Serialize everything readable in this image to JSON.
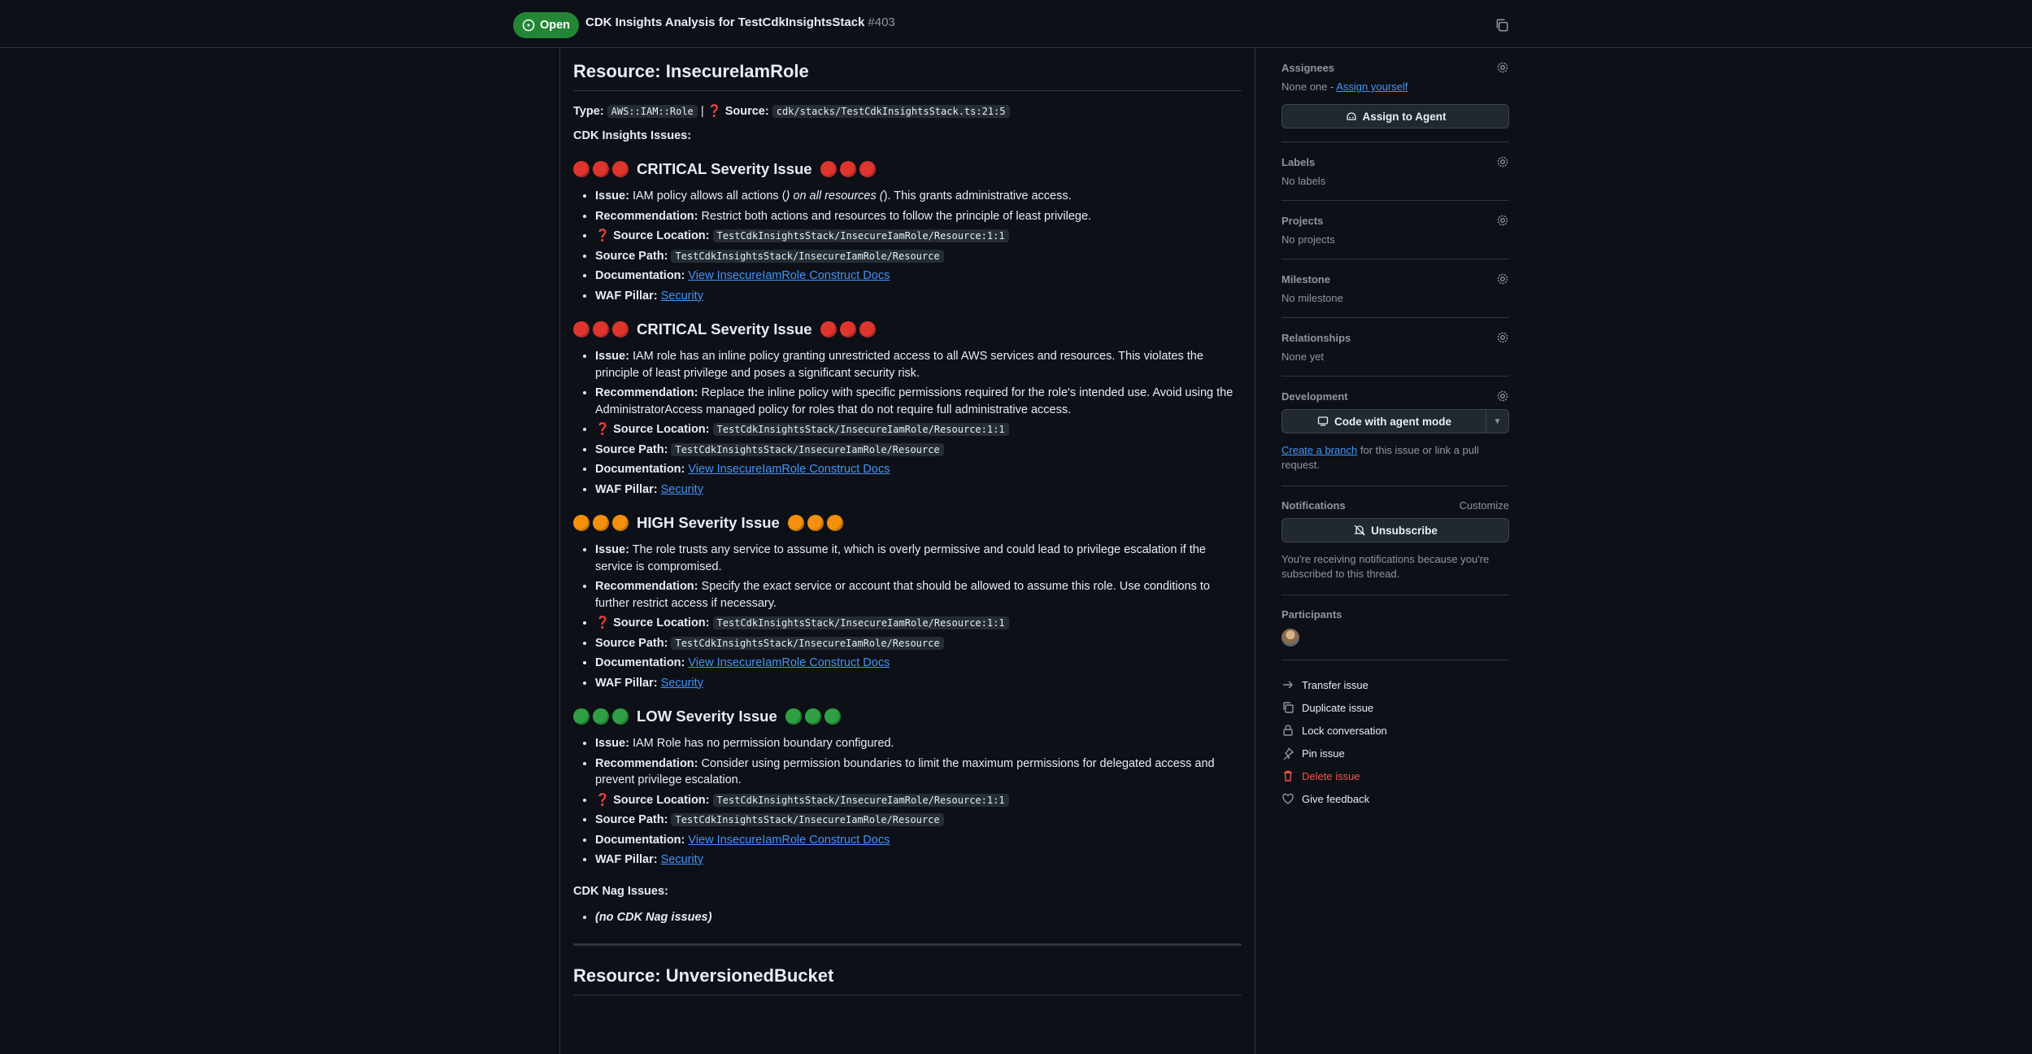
{
  "header": {
    "status": "Open",
    "title": "CDK Insights Analysis for TestCdkInsightsStack",
    "number": "#403"
  },
  "resource1": {
    "title": "Resource: InsecureIamRole",
    "type_label": "Type:",
    "type_value": "AWS::IAM::Role",
    "sep": "|",
    "source_label": "Source:",
    "source_value": "cdk/stacks/TestCdkInsightsStack.ts:21:5",
    "insights_label": "CDK Insights Issues:",
    "issues": [
      {
        "severity": "CRITICAL Severity Issue",
        "issue_label": "Issue:",
        "issue_text_pre": "IAM policy allows all actions (",
        "issue_text_em": ") on all resources (",
        "issue_text_post": "). This grants administrative access.",
        "rec_label": "Recommendation:",
        "rec_text": "Restrict both actions and resources to follow the principle of least privilege.",
        "loc_label": "Source Location:",
        "loc_value": "TestCdkInsightsStack/InsecureIamRole/Resource:1:1",
        "path_label": "Source Path:",
        "path_value": "TestCdkInsightsStack/InsecureIamRole/Resource",
        "doc_label": "Documentation:",
        "doc_link": "View InsecureIamRole Construct Docs",
        "waf_label": "WAF Pillar:",
        "waf_link": "Security"
      },
      {
        "severity": "CRITICAL Severity Issue",
        "issue_label": "Issue:",
        "issue_text": "IAM role has an inline policy granting unrestricted access to all AWS services and resources. This violates the principle of least privilege and poses a significant security risk.",
        "rec_label": "Recommendation:",
        "rec_text": "Replace the inline policy with specific permissions required for the role's intended use. Avoid using the AdministratorAccess managed policy for roles that do not require full administrative access.",
        "loc_label": "Source Location:",
        "loc_value": "TestCdkInsightsStack/InsecureIamRole/Resource:1:1",
        "path_label": "Source Path:",
        "path_value": "TestCdkInsightsStack/InsecureIamRole/Resource",
        "doc_label": "Documentation:",
        "doc_link": "View InsecureIamRole Construct Docs",
        "waf_label": "WAF Pillar:",
        "waf_link": "Security"
      },
      {
        "severity": "HIGH Severity Issue",
        "issue_label": "Issue:",
        "issue_text": "The role trusts any service to assume it, which is overly permissive and could lead to privilege escalation if the service is compromised.",
        "rec_label": "Recommendation:",
        "rec_text": "Specify the exact service or account that should be allowed to assume this role. Use conditions to further restrict access if necessary.",
        "loc_label": "Source Location:",
        "loc_value": "TestCdkInsightsStack/InsecureIamRole/Resource:1:1",
        "path_label": "Source Path:",
        "path_value": "TestCdkInsightsStack/InsecureIamRole/Resource",
        "doc_label": "Documentation:",
        "doc_link": "View InsecureIamRole Construct Docs",
        "waf_label": "WAF Pillar:",
        "waf_link": "Security"
      },
      {
        "severity": "LOW Severity Issue",
        "issue_label": "Issue:",
        "issue_text": "IAM Role has no permission boundary configured.",
        "rec_label": "Recommendation:",
        "rec_text": "Consider using permission boundaries to limit the maximum permissions for delegated access and prevent privilege escalation.",
        "loc_label": "Source Location:",
        "loc_value": "TestCdkInsightsStack/InsecureIamRole/Resource:1:1",
        "path_label": "Source Path:",
        "path_value": "TestCdkInsightsStack/InsecureIamRole/Resource",
        "doc_label": "Documentation:",
        "doc_link": "View InsecureIamRole Construct Docs",
        "waf_label": "WAF Pillar:",
        "waf_link": "Security"
      }
    ],
    "nag_label": "CDK Nag Issues:",
    "nag_item": "(no CDK Nag issues)"
  },
  "resource2": {
    "title": "Resource: UnversionedBucket"
  },
  "sidebar": {
    "assignees": {
      "label": "Assignees",
      "value": "None one - ",
      "link": "Assign yourself",
      "button": "Assign to Agent"
    },
    "labels": {
      "label": "Labels",
      "value": "No labels"
    },
    "projects": {
      "label": "Projects",
      "value": "No projects"
    },
    "milestone": {
      "label": "Milestone",
      "value": "No milestone"
    },
    "relationships": {
      "label": "Relationships",
      "value": "None yet"
    },
    "development": {
      "label": "Development",
      "button": "Code with agent mode",
      "link": "Create a branch",
      "note": " for this issue or link a pull request."
    },
    "notifications": {
      "label": "Notifications",
      "customize": "Customize",
      "button": "Unsubscribe",
      "note": "You're receiving notifications because you're subscribed to this thread."
    },
    "participants": {
      "label": "Participants"
    },
    "actions": [
      "Transfer issue",
      "Duplicate issue",
      "Lock conversation",
      "Pin issue",
      "Delete issue",
      "Give feedback"
    ]
  },
  "colors": {
    "open": "#238636",
    "link": "#4493f8",
    "danger": "#f85149",
    "critical": "#e0342f",
    "high": "#f4900c",
    "low": "#2ea043"
  }
}
